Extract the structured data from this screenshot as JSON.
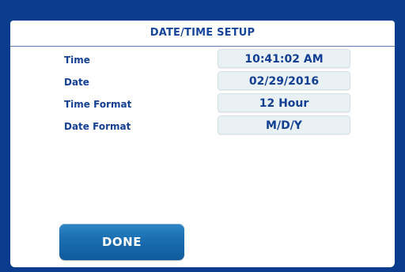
{
  "title": "DATE/TIME SETUP",
  "fields": [
    {
      "label": "Time",
      "value": "10:41:02 AM"
    },
    {
      "label": "Date",
      "value": "02/29/2016"
    },
    {
      "label": "Time Format",
      "value": "12 Hour"
    },
    {
      "label": "Date Format",
      "value": "M/D/Y"
    }
  ],
  "done_label": "DONE",
  "colors": {
    "frame": "#0c3c8e",
    "text_blue": "#123f93",
    "field_bg": "#e9f1f5",
    "button_blue": "#1b6fb3"
  }
}
